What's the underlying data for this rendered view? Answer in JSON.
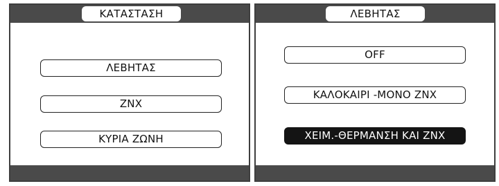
{
  "left_screen": {
    "title": "ΚΑΤΑΣΤΑΣΗ",
    "items": [
      {
        "label": "ΛΕΒΗΤΑΣ",
        "selected": false
      },
      {
        "label": "ΖΝΧ",
        "selected": false
      },
      {
        "label": "ΚΥΡΙΑ ΖΩΝΗ",
        "selected": false
      }
    ]
  },
  "right_screen": {
    "title": "ΛΕΒΗΤΑΣ",
    "items": [
      {
        "label": "OFF",
        "selected": false
      },
      {
        "label": "ΚΑΛΟΚΑΙΡΙ -ΜΟΝΟ ΖΝΧ",
        "selected": false
      },
      {
        "label": "ΧΕΙΜ.-ΘΕΡΜΑΝΣΗ ΚΑΙ ΖΝΧ",
        "selected": true
      }
    ]
  },
  "colors": {
    "bar": "#4a4a4a",
    "selected_background": "#141414",
    "selected_text": "#ffffff"
  }
}
